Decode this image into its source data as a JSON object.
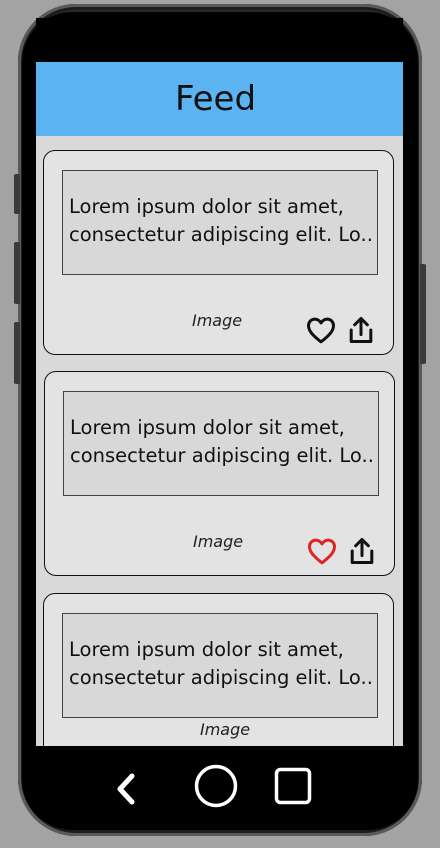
{
  "app": {
    "title": "Feed"
  },
  "colors": {
    "appbar": "#5cb3f2",
    "liked": "#e02424",
    "icon": "#111111"
  },
  "feed": {
    "items": [
      {
        "text_line1": "Lorem ipsum dolor sit amet,",
        "text_line2": "consectetur adipiscing elit. Lo...",
        "image_caption": "Image",
        "liked": false,
        "like_icon": "heart-outline-icon",
        "share_icon": "share-icon"
      },
      {
        "text_line1": "Lorem ipsum dolor sit amet,",
        "text_line2": "consectetur adipiscing elit. Lo...",
        "image_caption": "Image",
        "liked": true,
        "like_icon": "heart-outline-red-icon",
        "share_icon": "share-icon"
      },
      {
        "text_line1": "Lorem ipsum dolor sit amet,",
        "text_line2": "consectetur adipiscing elit. Lo...",
        "image_caption": "Image"
      }
    ]
  },
  "system_nav": {
    "back_icon": "back-chevron-icon",
    "home_icon": "home-circle-icon",
    "recents_icon": "recents-square-icon"
  }
}
